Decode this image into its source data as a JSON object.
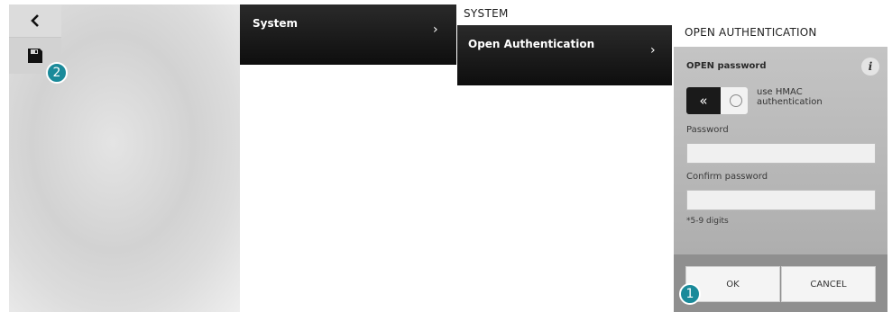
{
  "device": {
    "back_icon": "chevron-left-icon",
    "save_icon": "floppy-disk-icon",
    "badge_save": "2"
  },
  "menu": {
    "system_label": "System",
    "system_chevron": "›",
    "section_title": "SYSTEM",
    "open_auth_label": "Open Authentication",
    "open_auth_chevron": "›"
  },
  "auth": {
    "title": "OPEN AUTHENTICATION",
    "open_password_label": "OPEN password",
    "info_icon": "i",
    "toggle_icon": "«",
    "hmac_label": "use HMAC authentication",
    "password_label": "Password",
    "password_value": "",
    "confirm_label": "Confirm password",
    "confirm_value": "",
    "note": "*5-9 digits",
    "ok_label": "OK",
    "cancel_label": "CANCEL",
    "badge_ok": "1"
  },
  "colors": {
    "menu_bg": "#111111",
    "panel_bg": "#b5b5b5",
    "badge": "#1a8a9a"
  }
}
